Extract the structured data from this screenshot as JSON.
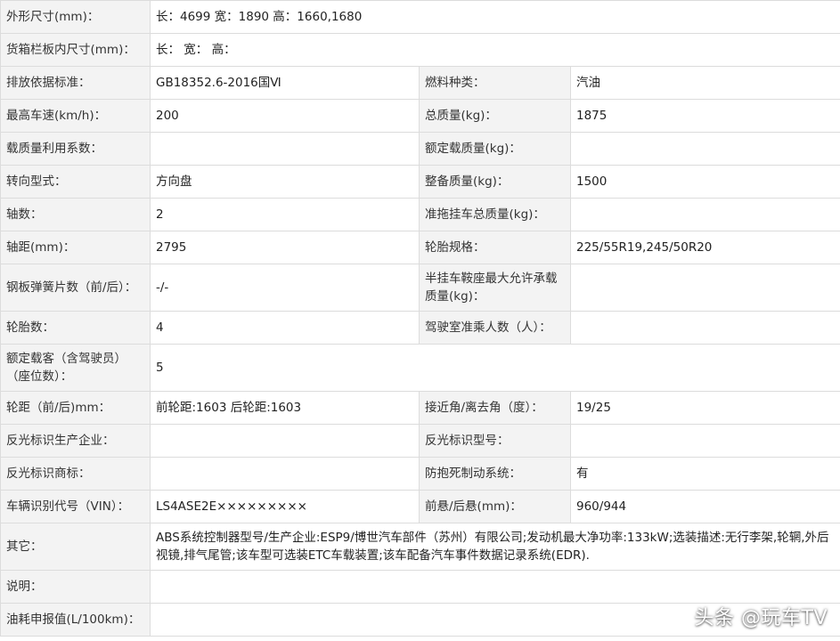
{
  "rows": [
    {
      "l1": "外形尺寸(mm)：",
      "v1": "长：4699 宽：1890 高：1660,1680"
    },
    {
      "l1": "货箱栏板内尺寸(mm)：",
      "v1": "长： 宽： 高："
    },
    {
      "l1": "排放依据标准：",
      "v1": "GB18352.6-2016国Ⅵ",
      "l2": "燃料种类：",
      "v2": "汽油"
    },
    {
      "l1": "最高车速(km/h)：",
      "v1": "200",
      "l2": "总质量(kg)：",
      "v2": "1875"
    },
    {
      "l1": "载质量利用系数：",
      "v1": "",
      "l2": "额定载质量(kg)：",
      "v2": ""
    },
    {
      "l1": "转向型式：",
      "v1": "方向盘",
      "l2": "整备质量(kg)：",
      "v2": "1500"
    },
    {
      "l1": "轴数：",
      "v1": "2",
      "l2": "准拖挂车总质量(kg)：",
      "v2": ""
    },
    {
      "l1": "轴距(mm)：",
      "v1": "2795",
      "l2": "轮胎规格：",
      "v2": "225/55R19,245/50R20"
    },
    {
      "l1": "钢板弹簧片数（前/后）：",
      "v1": "-/-",
      "l2": "半挂车鞍座最大允许承载质量(kg)：",
      "v2": ""
    },
    {
      "l1": "轮胎数：",
      "v1": "4",
      "l2": "驾驶室准乘人数（人）：",
      "v2": ""
    },
    {
      "l1": "额定载客（含驾驶员）（座位数）：",
      "v1": "5"
    },
    {
      "l1": "轮距（前/后)mm：",
      "v1": "前轮距:1603 后轮距:1603",
      "l2": "接近角/离去角（度）：",
      "v2": "19/25"
    },
    {
      "l1": "反光标识生产企业：",
      "v1": "",
      "l2": "反光标识型号：",
      "v2": ""
    },
    {
      "l1": "反光标识商标：",
      "v1": "",
      "l2": "防抱死制动系统：",
      "v2": "有"
    },
    {
      "l1": "车辆识别代号（VIN）：",
      "v1": "LS4ASE2E×××××××××",
      "l2": "前悬/后悬(mm)：",
      "v2": "960/944"
    },
    {
      "l1": "其它：",
      "v1": "ABS系统控制器型号/生产企业:ESP9/博世汽车部件（苏州）有限公司;发动机最大净功率:133kW;选装描述:无行李架,轮辋,外后视镜,排气尾管;该车型可选装ETC车载装置;该车配备汽车事件数据记录系统(EDR)."
    },
    {
      "l1": "说明：",
      "v1": ""
    },
    {
      "l1": "油耗申报值(L/100km)：",
      "v1": ""
    }
  ],
  "watermark": "头条 @玩车TV"
}
